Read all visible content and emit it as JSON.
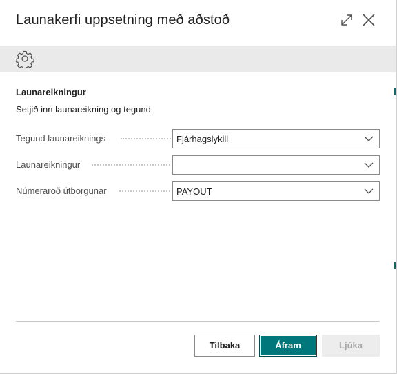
{
  "dialog": {
    "title": "Launakerfi uppsetning með aðstoð",
    "expand_icon": "expand-diagonal-icon",
    "close_icon": "close-x-icon"
  },
  "toolbar": {
    "settings_icon": "gear-icon"
  },
  "section": {
    "title": "Launareikningur",
    "description": "Setjið inn launareikning og tegund"
  },
  "fields": [
    {
      "label": "Tegund launareiknings",
      "value": "Fjárhagslykill"
    },
    {
      "label": "Launareikningur",
      "value": ""
    },
    {
      "label": "Númeraröð útborgunar",
      "value": "PAYOUT"
    }
  ],
  "footer": {
    "back_label": "Tilbaka",
    "next_label": "Áfram",
    "finish_label": "Ljúka"
  },
  "colors": {
    "accent": "#00777b",
    "toolbar_bg": "#eaeaea",
    "disabled_bg": "#ededed"
  }
}
